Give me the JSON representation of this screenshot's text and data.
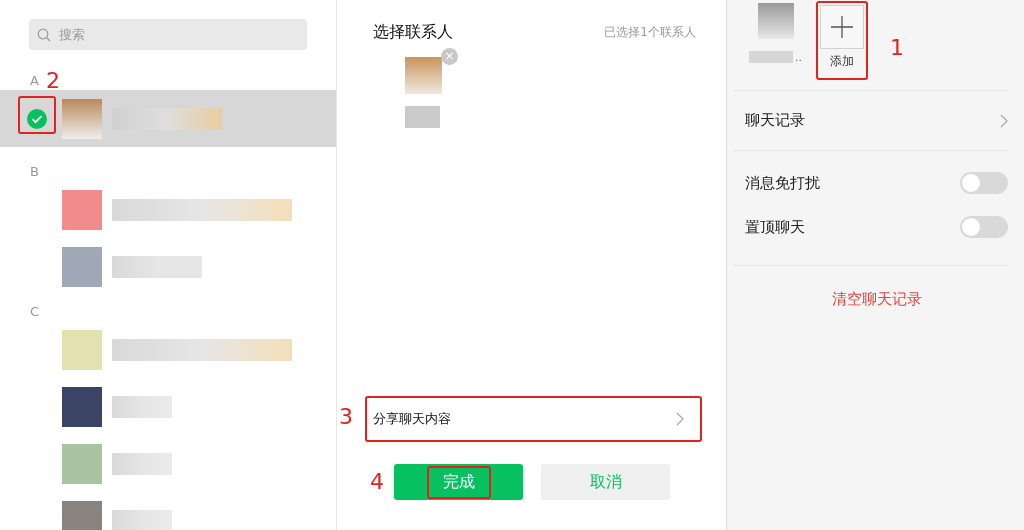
{
  "contacts_panel": {
    "search": {
      "placeholder": "搜索"
    },
    "sections": [
      {
        "letter": "A",
        "contacts": [
          {
            "selected": true,
            "annotation": "2"
          }
        ]
      },
      {
        "letter": "B",
        "contacts": [
          {
            "selected": false
          },
          {
            "selected": false
          }
        ]
      },
      {
        "letter": "C",
        "contacts": [
          {
            "selected": false
          },
          {
            "selected": false
          },
          {
            "selected": false
          },
          {
            "selected": false
          }
        ]
      }
    ]
  },
  "selection_panel": {
    "title": "选择联系人",
    "count": "已选择1个联系人",
    "selected_contacts": [
      {
        "remove": "×"
      }
    ],
    "share_option": {
      "label": "分享聊天内容",
      "annotation": "3"
    },
    "buttons": [
      {
        "kind": "primary",
        "label": "完成",
        "annotation": "4"
      },
      {
        "kind": "secondary",
        "label": "取消"
      }
    ]
  },
  "chat_info": {
    "member": {
      "name_ellipsis": ".."
    },
    "add_button": {
      "label": "添加",
      "annotation": "1"
    },
    "rows": [
      {
        "kind": "link",
        "label": "聊天记录"
      },
      {
        "kind": "toggle",
        "label": "消息免打扰",
        "on": false
      },
      {
        "kind": "toggle",
        "label": "置顶聊天",
        "on": false
      }
    ],
    "clear_history": "清空聊天记录"
  }
}
